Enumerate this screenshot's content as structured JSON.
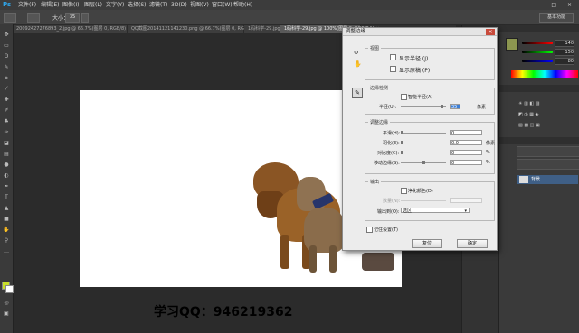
{
  "app": {
    "logo": "Ps"
  },
  "menu": [
    "文件(F)",
    "编辑(E)",
    "图像(I)",
    "图层(L)",
    "文字(Y)",
    "选择(S)",
    "滤镜(T)",
    "3D(D)",
    "视图(V)",
    "窗口(W)",
    "帮助(H)"
  ],
  "window_controls": "- □ ×",
  "options": {
    "size_label": "大小：",
    "size_value": "35",
    "workspace": "基本功能"
  },
  "tabs": [
    "20092427276893_2.jpg @ 66.7%(图层 0, RGB/8)",
    "QQ截图20141121141230.png @ 66.7%(图层 0, RGB/8)",
    "1码科学-29.jpg @ 100%(RGB/8)",
    "1码科学-29.jpg @ 100%(图层 0, RGB/8#) ×"
  ],
  "watermark": "学习QQ：946219362",
  "color_panel": {
    "r": "140",
    "g": "150",
    "b": "80"
  },
  "layers": {
    "layer_name": "背景"
  },
  "dialog": {
    "title": "调整边缘",
    "view_group": "视图",
    "show_radius": "显示半径 (J)",
    "show_original": "显示原稿 (P)",
    "edge_group": "边缘检测",
    "smart_radius": "智能半径(A)",
    "radius_label": "半径(U):",
    "radius_value": "35",
    "radius_unit": "像素",
    "adjust_group": "调整边缘",
    "smooth_label": "平滑(H):",
    "smooth_value": "0",
    "feather_label": "羽化(E):",
    "feather_value": "0.0",
    "feather_unit": "像素",
    "contrast_label": "对比度(C):",
    "contrast_value": "0",
    "contrast_unit": "%",
    "shift_label": "移动边缘(S):",
    "shift_value": "0",
    "shift_unit": "%",
    "output_group": "输出",
    "decontam": "净化颜色(D)",
    "amount_label": "数量(N):",
    "output_to_label": "输出到(O):",
    "output_to_value": "选区",
    "remember": "记住设置(T)",
    "cancel": "复位",
    "ok": "确定"
  },
  "colors": {
    "accent": "#2fa3e6",
    "foreground": "#c9df2a",
    "dialog_bg": "#ececec"
  }
}
